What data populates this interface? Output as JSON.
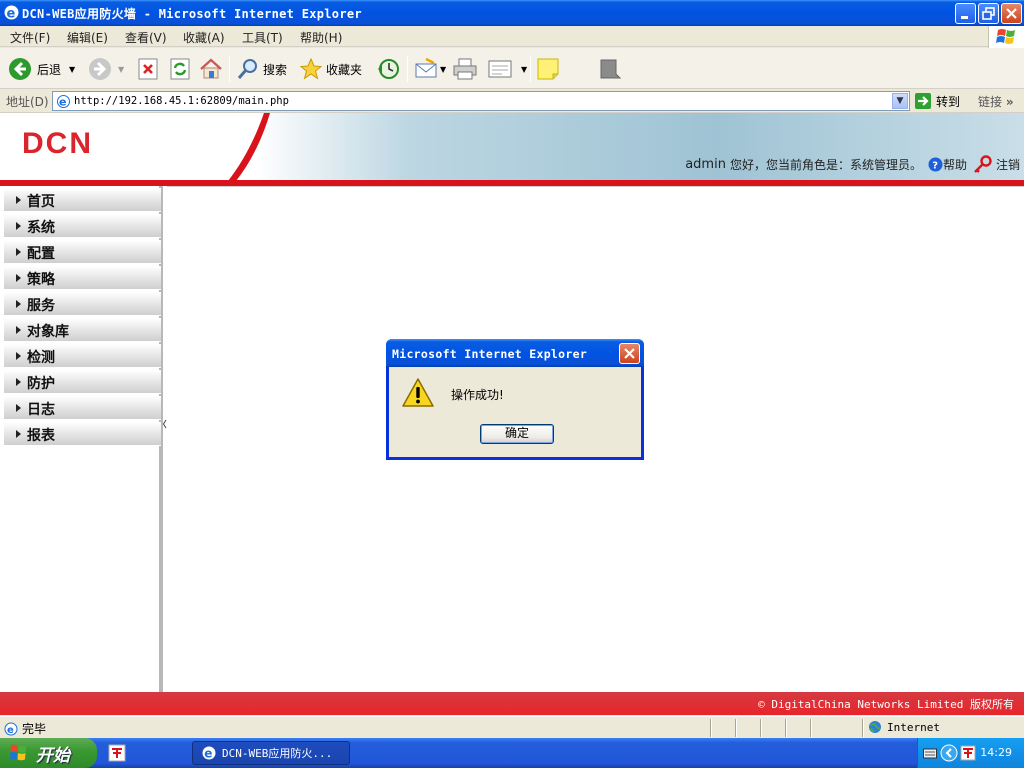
{
  "window": {
    "title": "DCN-WEB应用防火墙 - Microsoft Internet Explorer",
    "controls": [
      "minimize",
      "restore",
      "close"
    ]
  },
  "menubar": {
    "items": [
      "文件(F)",
      "编辑(E)",
      "查看(V)",
      "收藏(A)",
      "工具(T)",
      "帮助(H)"
    ]
  },
  "toolbar": {
    "back_label": "后退",
    "search_label": "搜索",
    "favorites_label": "收藏夹"
  },
  "addressbar": {
    "label": "地址(D)",
    "url": "http://192.168.45.1:62809/main.php",
    "go_label": "转到",
    "links_label": "链接"
  },
  "header": {
    "logo": "DCN",
    "user": "admin",
    "greeting": "您好，您当前角色是：系统管理员。",
    "help_label": "帮助",
    "logout_label": "注销"
  },
  "sidebar": {
    "items": [
      {
        "label": "首页"
      },
      {
        "label": "系统"
      },
      {
        "label": "配置"
      },
      {
        "label": "策略"
      },
      {
        "label": "服务"
      },
      {
        "label": "对象库"
      },
      {
        "label": "检测"
      },
      {
        "label": "防护"
      },
      {
        "label": "日志"
      },
      {
        "label": "报表"
      }
    ]
  },
  "footer": {
    "copyright": "© DigitalChina Networks Limited 版权所有"
  },
  "statusbar": {
    "status": "完毕",
    "zone": "Internet"
  },
  "taskbar": {
    "start_label": "开始",
    "task_label": "DCN-WEB应用防火...",
    "clock": "14:29"
  },
  "dialog": {
    "title": "Microsoft Internet Explorer",
    "message": "操作成功!",
    "ok_label": "确定"
  },
  "colors": {
    "accent_red": "#d9131b",
    "xp_blue": "#0054e3"
  }
}
